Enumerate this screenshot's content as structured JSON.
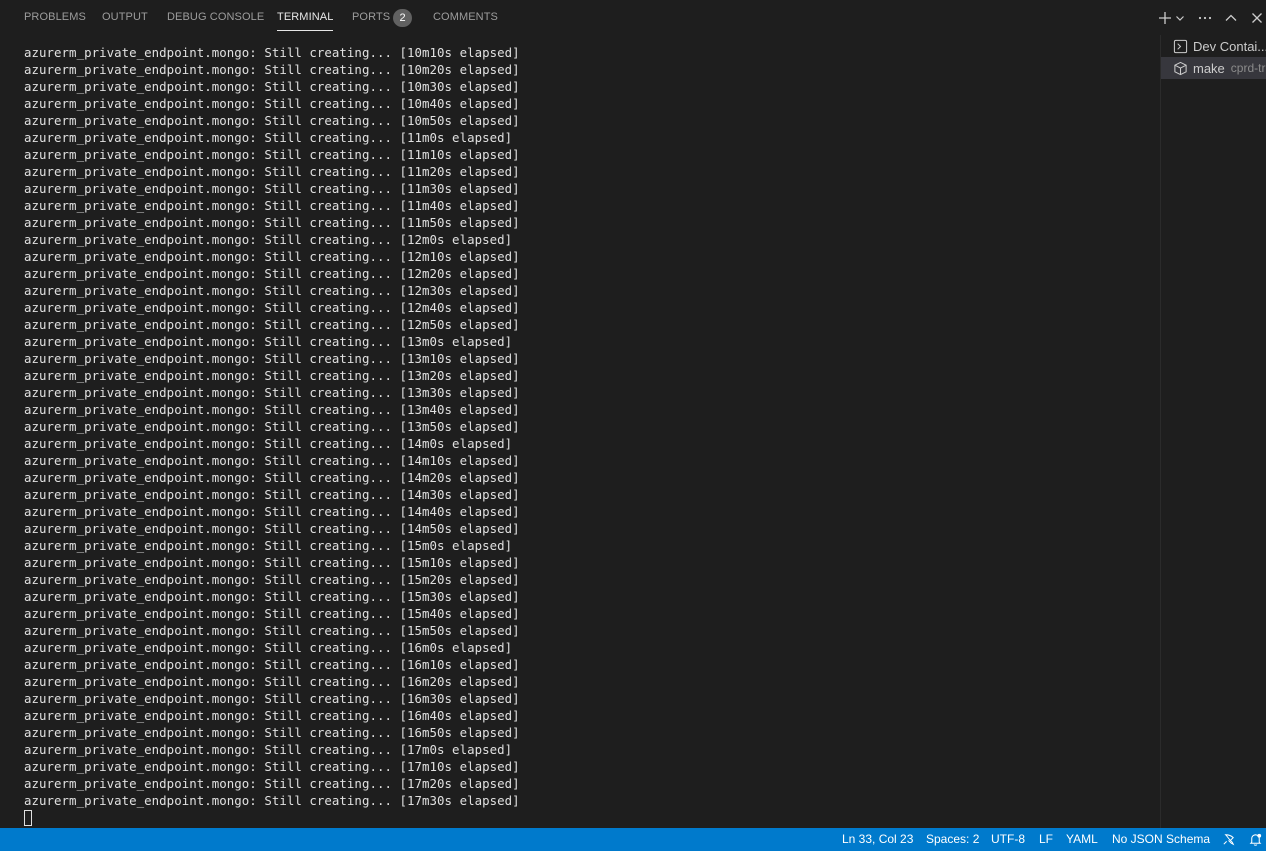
{
  "panel": {
    "tabs": [
      {
        "label": "PROBLEMS"
      },
      {
        "label": "OUTPUT"
      },
      {
        "label": "DEBUG CONSOLE"
      },
      {
        "label": "TERMINAL"
      },
      {
        "label": "PORTS"
      },
      {
        "label": "COMMENTS"
      }
    ],
    "active_tab": "TERMINAL",
    "ports_badge": "2",
    "actions": [
      "plus-icon",
      "chevron-down-icon",
      "more-icon",
      "chevron-up-icon",
      "close-icon"
    ]
  },
  "terminal": {
    "lines": [
      "azurerm_private_endpoint.mongo: Still creating... [10m10s elapsed]",
      "azurerm_private_endpoint.mongo: Still creating... [10m20s elapsed]",
      "azurerm_private_endpoint.mongo: Still creating... [10m30s elapsed]",
      "azurerm_private_endpoint.mongo: Still creating... [10m40s elapsed]",
      "azurerm_private_endpoint.mongo: Still creating... [10m50s elapsed]",
      "azurerm_private_endpoint.mongo: Still creating... [11m0s elapsed]",
      "azurerm_private_endpoint.mongo: Still creating... [11m10s elapsed]",
      "azurerm_private_endpoint.mongo: Still creating... [11m20s elapsed]",
      "azurerm_private_endpoint.mongo: Still creating... [11m30s elapsed]",
      "azurerm_private_endpoint.mongo: Still creating... [11m40s elapsed]",
      "azurerm_private_endpoint.mongo: Still creating... [11m50s elapsed]",
      "azurerm_private_endpoint.mongo: Still creating... [12m0s elapsed]",
      "azurerm_private_endpoint.mongo: Still creating... [12m10s elapsed]",
      "azurerm_private_endpoint.mongo: Still creating... [12m20s elapsed]",
      "azurerm_private_endpoint.mongo: Still creating... [12m30s elapsed]",
      "azurerm_private_endpoint.mongo: Still creating... [12m40s elapsed]",
      "azurerm_private_endpoint.mongo: Still creating... [12m50s elapsed]",
      "azurerm_private_endpoint.mongo: Still creating... [13m0s elapsed]",
      "azurerm_private_endpoint.mongo: Still creating... [13m10s elapsed]",
      "azurerm_private_endpoint.mongo: Still creating... [13m20s elapsed]",
      "azurerm_private_endpoint.mongo: Still creating... [13m30s elapsed]",
      "azurerm_private_endpoint.mongo: Still creating... [13m40s elapsed]",
      "azurerm_private_endpoint.mongo: Still creating... [13m50s elapsed]",
      "azurerm_private_endpoint.mongo: Still creating... [14m0s elapsed]",
      "azurerm_private_endpoint.mongo: Still creating... [14m10s elapsed]",
      "azurerm_private_endpoint.mongo: Still creating... [14m20s elapsed]",
      "azurerm_private_endpoint.mongo: Still creating... [14m30s elapsed]",
      "azurerm_private_endpoint.mongo: Still creating... [14m40s elapsed]",
      "azurerm_private_endpoint.mongo: Still creating... [14m50s elapsed]",
      "azurerm_private_endpoint.mongo: Still creating... [15m0s elapsed]",
      "azurerm_private_endpoint.mongo: Still creating... [15m10s elapsed]",
      "azurerm_private_endpoint.mongo: Still creating... [15m20s elapsed]",
      "azurerm_private_endpoint.mongo: Still creating... [15m30s elapsed]",
      "azurerm_private_endpoint.mongo: Still creating... [15m40s elapsed]",
      "azurerm_private_endpoint.mongo: Still creating... [15m50s elapsed]",
      "azurerm_private_endpoint.mongo: Still creating... [16m0s elapsed]",
      "azurerm_private_endpoint.mongo: Still creating... [16m10s elapsed]",
      "azurerm_private_endpoint.mongo: Still creating... [16m20s elapsed]",
      "azurerm_private_endpoint.mongo: Still creating... [16m30s elapsed]",
      "azurerm_private_endpoint.mongo: Still creating... [16m40s elapsed]",
      "azurerm_private_endpoint.mongo: Still creating... [16m50s elapsed]",
      "azurerm_private_endpoint.mongo: Still creating... [17m0s elapsed]",
      "azurerm_private_endpoint.mongo: Still creating... [17m10s elapsed]",
      "azurerm_private_endpoint.mongo: Still creating... [17m20s elapsed]",
      "azurerm_private_endpoint.mongo: Still creating... [17m30s elapsed]"
    ]
  },
  "terminal_tabs": [
    {
      "label": "Dev Contai...",
      "icon": "terminal-icon",
      "description": ""
    },
    {
      "label": "make",
      "icon": "package-icon",
      "description": "cprd-tre"
    }
  ],
  "statusbar": {
    "cursor_position": "Ln 33, Col 23",
    "indentation": "Spaces: 2",
    "encoding": "UTF-8",
    "eol": "LF",
    "language": "YAML",
    "schema": "No JSON Schema",
    "icons": [
      "feedback-icon",
      "bell-icon"
    ]
  },
  "colors": {
    "background": "#1e1e1e",
    "statusbar": "#007acc",
    "text": "#e0e0e0"
  }
}
